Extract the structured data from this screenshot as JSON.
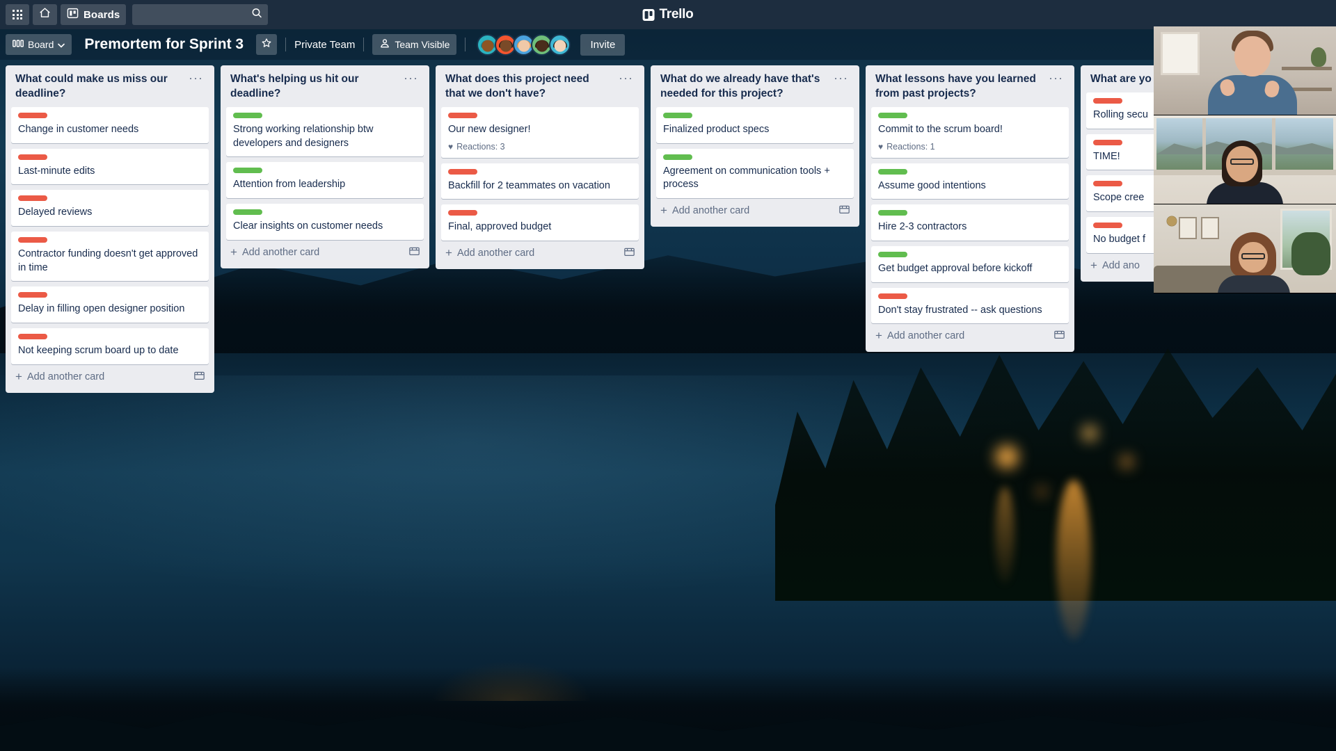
{
  "topnav": {
    "apps_icon": "grid-apps-icon",
    "home_icon": "home-icon",
    "boards_icon": "boards-icon",
    "boards_label": "Boards",
    "search_placeholder": "",
    "search_value": "",
    "search_icon": "search-icon",
    "brand": "Trello"
  },
  "boardbar": {
    "board_button_label": "Board",
    "board_button_icon": "board-view-icon",
    "chevron_icon": "chevron-down-icon",
    "title": "Premortem for Sprint 3",
    "star_icon": "star-icon",
    "privacy_label": "Private Team",
    "visibility_label": "Team Visible",
    "visibility_icon": "team-visible-icon",
    "invite_label": "Invite",
    "members": [
      {
        "name": "member-avatar-1",
        "bg": "#2bb3c0",
        "skin": "#8d5524",
        "hair": "#1b7f8c"
      },
      {
        "name": "member-avatar-2",
        "bg": "#f4552f",
        "skin": "#7a4a28",
        "hair": "#1a1a1a"
      },
      {
        "name": "member-avatar-3",
        "bg": "#4aa3df",
        "skin": "#f0c9a8",
        "hair": "#e8903a"
      },
      {
        "name": "member-avatar-4",
        "bg": "#6fbf7a",
        "skin": "#4a2d1c",
        "hair": "#2a1a10"
      },
      {
        "name": "member-avatar-5",
        "bg": "#3fb8d4",
        "skin": "#f2d3b8",
        "hair": "#221a16"
      }
    ]
  },
  "lists": [
    {
      "title": "What could make us miss our deadline?",
      "menu_icon": "list-menu-icon",
      "add_card_label": "Add another card",
      "add_template_icon": "card-template-icon",
      "cards": [
        {
          "label_color": "red",
          "title": "Change in customer needs"
        },
        {
          "label_color": "red",
          "title": "Last-minute edits"
        },
        {
          "label_color": "red",
          "title": "Delayed reviews"
        },
        {
          "label_color": "red",
          "title": "Contractor funding doesn't get approved in time"
        },
        {
          "label_color": "red",
          "title": "Delay in filling open designer position"
        },
        {
          "label_color": "red",
          "title": "Not keeping scrum board up to date"
        }
      ]
    },
    {
      "title": "What's helping us hit our deadline?",
      "menu_icon": "list-menu-icon",
      "add_card_label": "Add another card",
      "add_template_icon": "card-template-icon",
      "cards": [
        {
          "label_color": "green",
          "title": "Strong working relationship btw developers and designers"
        },
        {
          "label_color": "green",
          "title": "Attention from leadership"
        },
        {
          "label_color": "green",
          "title": "Clear insights on customer needs"
        }
      ]
    },
    {
      "title": "What does this project need that we don't have?",
      "menu_icon": "list-menu-icon",
      "add_card_label": "Add another card",
      "add_template_icon": "card-template-icon",
      "cards": [
        {
          "label_color": "red",
          "title": "Our new designer!",
          "reactions": "Reactions: 3",
          "reaction_icon": "heart-icon"
        },
        {
          "label_color": "red",
          "title": "Backfill for 2 teammates on vacation"
        },
        {
          "label_color": "red",
          "title": "Final, approved budget"
        }
      ]
    },
    {
      "title": "What do we already have that's needed for this project?",
      "menu_icon": "list-menu-icon",
      "add_card_label": "Add another card",
      "add_template_icon": "card-template-icon",
      "cards": [
        {
          "label_color": "green",
          "title": "Finalized product specs"
        },
        {
          "label_color": "green",
          "title": "Agreement on communication tools + process"
        }
      ]
    },
    {
      "title": "What lessons have you learned from past projects?",
      "menu_icon": "list-menu-icon",
      "add_card_label": "Add another card",
      "add_template_icon": "card-template-icon",
      "cards": [
        {
          "label_color": "green",
          "title": "Commit to the scrum board!",
          "reactions": "Reactions: 1",
          "reaction_icon": "heart-icon"
        },
        {
          "label_color": "green",
          "title": "Assume good intentions"
        },
        {
          "label_color": "green",
          "title": "Hire 2-3 contractors"
        },
        {
          "label_color": "green",
          "title": "Get budget approval before kickoff"
        },
        {
          "label_color": "red",
          "title": "Don't stay frustrated -- ask questions"
        }
      ]
    },
    {
      "title": "What are yo",
      "menu_icon": "list-menu-icon",
      "add_card_label": "Add ano",
      "add_template_icon": "card-template-icon",
      "cards": [
        {
          "label_color": "red",
          "title": "Rolling secu"
        },
        {
          "label_color": "red",
          "title": "TIME!"
        },
        {
          "label_color": "red",
          "title": "Scope cree"
        },
        {
          "label_color": "red",
          "title": "No budget f"
        }
      ]
    }
  ],
  "video_call": {
    "participants": [
      {
        "name": "video-participant-1"
      },
      {
        "name": "video-participant-2"
      },
      {
        "name": "video-participant-3"
      }
    ]
  }
}
